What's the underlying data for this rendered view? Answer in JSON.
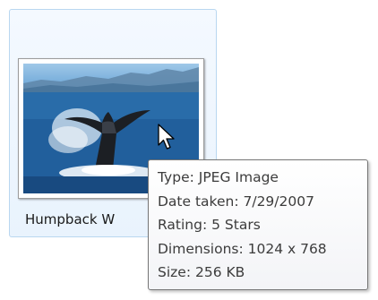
{
  "file": {
    "name": "Humpback W",
    "thumbnail_subject": "whale tail breaching ocean"
  },
  "tooltip": {
    "type_line": "Type: JPEG Image",
    "date_line": "Date taken: 7/29/2007",
    "rating_line": "Rating: 5 Stars",
    "dimensions_line": "Dimensions: 1024 x 768",
    "size_line": "Size: 256 KB"
  },
  "icons": {
    "cursor": "arrow-cursor-icon"
  },
  "colors": {
    "tile_border": "#b9d7f0",
    "tile_fill": "#eef5fd",
    "tooltip_border": "#767676",
    "tooltip_text": "#3c3c3c"
  }
}
